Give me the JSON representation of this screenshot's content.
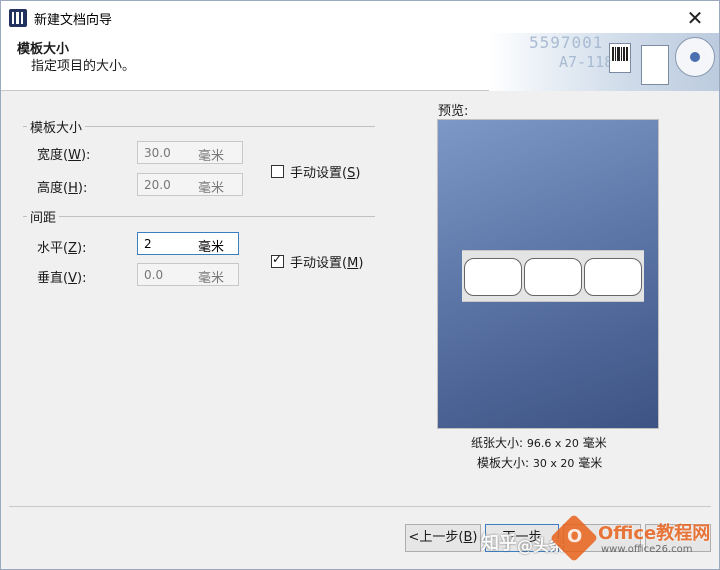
{
  "window": {
    "title": "新建文档向导",
    "close_symbol": "✕"
  },
  "header": {
    "title": "模板大小",
    "subtitle": "指定项目的大小。",
    "banner_text1": "5597001",
    "banner_text2": "A7-118"
  },
  "template_size": {
    "group_label": "模板大小",
    "width": {
      "label": "宽度",
      "accel": "W",
      "value": "30.0",
      "unit": "毫米"
    },
    "height": {
      "label": "高度",
      "accel": "H",
      "value": "20.0",
      "unit": "毫米"
    },
    "manual": {
      "label": "手动设置",
      "accel": "S",
      "checked": false
    }
  },
  "spacing": {
    "group_label": "间距",
    "horizontal": {
      "label": "水平",
      "accel": "Z",
      "value": "2",
      "unit": "毫米"
    },
    "vertical": {
      "label": "垂直",
      "accel": "V",
      "value": "0.0",
      "unit": "毫米"
    },
    "manual": {
      "label": "手动设置",
      "accel": "M",
      "checked": true
    }
  },
  "preview": {
    "title": "预览:",
    "paper_size_label": "纸张大小:",
    "paper_size_value": "96.6 x 20",
    "paper_size_unit": "毫米",
    "template_size_label": "模板大小:",
    "template_size_value": "30 x 20",
    "template_size_unit": "毫米"
  },
  "footer": {
    "back_label": "<上一步",
    "back_accel": "B",
    "next_label": "下一步"
  },
  "watermarks": {
    "zhihu": "知乎",
    "author": "@头条",
    "office_logo_letter": "O",
    "office_brand": "Office教程网",
    "office_url": "www.office26.com"
  },
  "colors": {
    "preview_top": "#7d98c6",
    "preview_bottom": "#3d5384",
    "accent": "#3c7fc0",
    "office_orange": "#e8611a"
  }
}
